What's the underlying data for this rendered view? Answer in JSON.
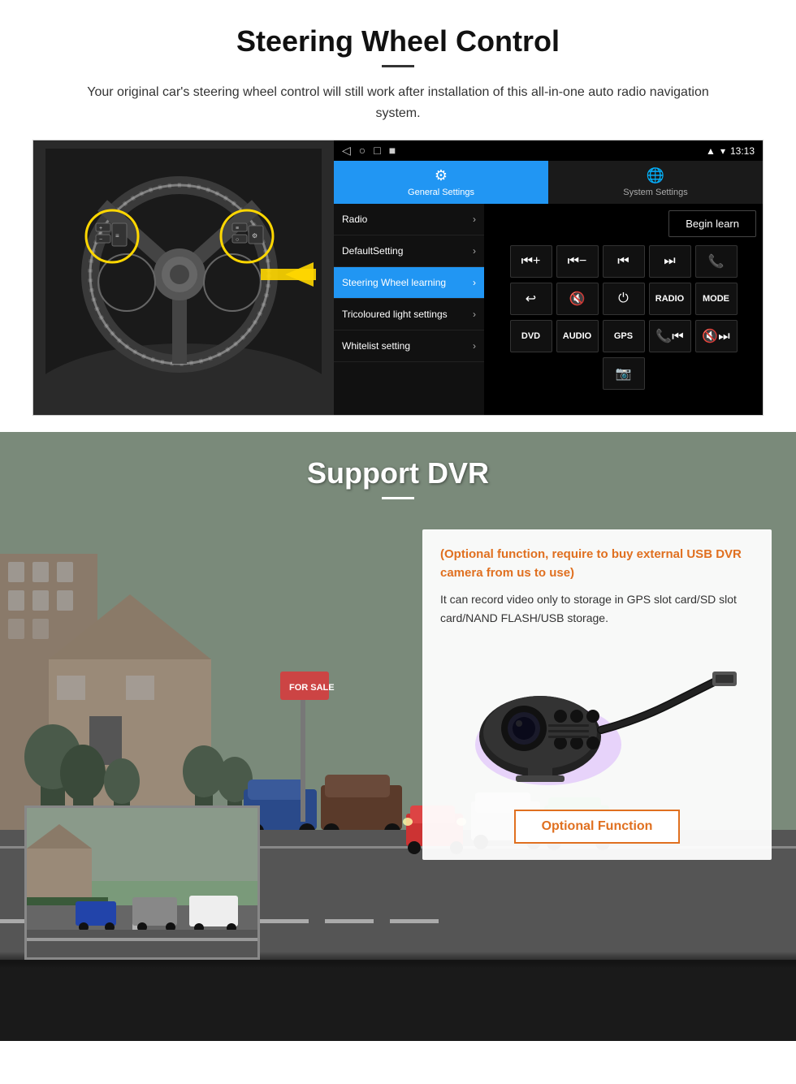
{
  "steering_section": {
    "title": "Steering Wheel Control",
    "description": "Your original car's steering wheel control will still work after installation of this all-in-one auto radio navigation system.",
    "status_bar": {
      "time": "13:13",
      "nav_icons": [
        "◁",
        "○",
        "□",
        "■"
      ]
    },
    "tabs": [
      {
        "id": "general",
        "label": "General Settings",
        "icon": "⚙",
        "active": true
      },
      {
        "id": "system",
        "label": "System Settings",
        "icon": "🌐",
        "active": false
      }
    ],
    "menu_items": [
      {
        "label": "Radio",
        "active": false
      },
      {
        "label": "DefaultSetting",
        "active": false
      },
      {
        "label": "Steering Wheel learning",
        "active": true
      },
      {
        "label": "Tricoloured light settings",
        "active": false
      },
      {
        "label": "Whitelist setting",
        "active": false
      }
    ],
    "begin_learn_label": "Begin learn",
    "control_buttons_row1": [
      "⏮+",
      "⏮−",
      "⏮|",
      "⏭|",
      "📞"
    ],
    "control_buttons_row2": [
      "↩",
      "🔇x",
      "⏻",
      "RADIO",
      "MODE"
    ],
    "control_buttons_row3": [
      "DVD",
      "AUDIO",
      "GPS",
      "📞|⏮|",
      "🔇⏭|"
    ],
    "control_buttons_row4": [
      "📷"
    ]
  },
  "dvr_section": {
    "title": "Support DVR",
    "optional_heading": "(Optional function, require to buy external USB DVR camera from us to use)",
    "description": "It can record video only to storage in GPS slot card/SD slot card/NAND FLASH/USB storage.",
    "optional_button_label": "Optional Function"
  }
}
